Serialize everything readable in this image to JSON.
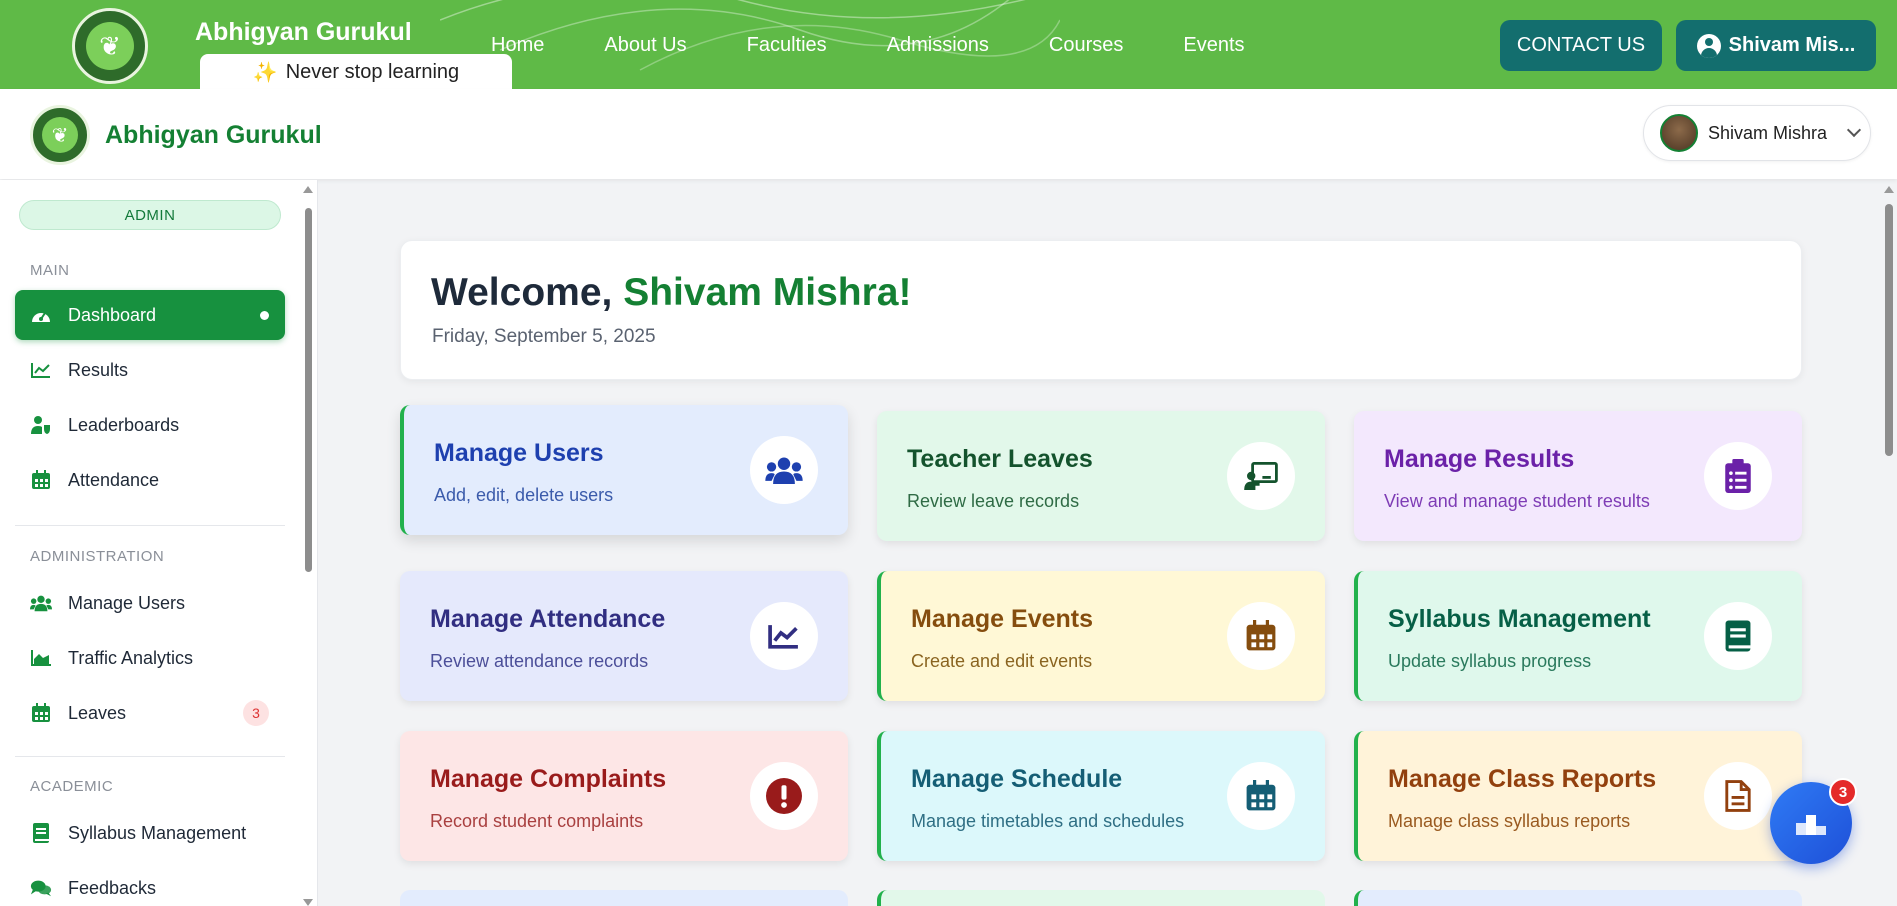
{
  "topbar": {
    "brand": "Abhigyan Gurukul",
    "tagline": "Never stop learning",
    "nav": [
      "Home",
      "About Us",
      "Faculties",
      "Admissions",
      "Courses",
      "Events"
    ],
    "contact_label": "CONTACT US",
    "user_label": "Shivam Mis...",
    "bg_color": "#5fba47",
    "button_color": "#136e6e"
  },
  "header": {
    "title": "Abhigyan Gurukul",
    "profile_name": "Shivam Mishra"
  },
  "sidebar": {
    "role_badge": "ADMIN",
    "sections": [
      {
        "title": "MAIN",
        "items": [
          {
            "label": "Dashboard",
            "icon": "gauge-icon",
            "active": true
          },
          {
            "label": "Results",
            "icon": "chart-line-icon"
          },
          {
            "label": "Leaderboards",
            "icon": "user-shield-icon"
          },
          {
            "label": "Attendance",
            "icon": "calendar-icon"
          }
        ]
      },
      {
        "title": "ADMINISTRATION",
        "items": [
          {
            "label": "Manage Users",
            "icon": "users-icon"
          },
          {
            "label": "Traffic Analytics",
            "icon": "chart-area-icon"
          },
          {
            "label": "Leaves",
            "icon": "calendar-icon",
            "badge": "3"
          }
        ]
      },
      {
        "title": "ACADEMIC",
        "items": [
          {
            "label": "Syllabus Management",
            "icon": "book-icon"
          },
          {
            "label": "Feedbacks",
            "icon": "comments-icon"
          }
        ]
      }
    ],
    "accent": "#17913f"
  },
  "welcome": {
    "greeting": "Welcome,",
    "name": "Shivam Mishra!",
    "date": "Friday, September 5, 2025"
  },
  "cards": [
    {
      "title": "Manage Users",
      "subtitle": "Add, edit, delete users",
      "icon": "users-icon",
      "bg": "#e3ecfd",
      "color": "#1e40af"
    },
    {
      "title": "Teacher Leaves",
      "subtitle": "Review leave records",
      "icon": "chalkboard-teacher-icon",
      "bg": "#e2f8ea",
      "color": "#14532d"
    },
    {
      "title": "Manage Results",
      "subtitle": "View and manage student results",
      "icon": "clipboard-list-icon",
      "bg": "#f3e8fd",
      "color": "#6b21a8"
    },
    {
      "title": "Manage Attendance",
      "subtitle": "Review attendance records",
      "icon": "chart-line-icon",
      "bg": "#e5e9fc",
      "color": "#312e81"
    },
    {
      "title": "Manage Events",
      "subtitle": "Create and edit events",
      "icon": "calendar-icon",
      "bg": "#fff8d6",
      "color": "#854d0e"
    },
    {
      "title": "Syllabus Management",
      "subtitle": "Update syllabus progress",
      "icon": "book-icon",
      "bg": "#dff8ec",
      "color": "#065f46"
    },
    {
      "title": "Manage Complaints",
      "subtitle": "Record student complaints",
      "icon": "exclamation-circle-icon",
      "bg": "#fde6e6",
      "color": "#991b1b"
    },
    {
      "title": "Manage Schedule",
      "subtitle": "Manage timetables and schedules",
      "icon": "calendar-icon",
      "bg": "#dcf8fb",
      "color": "#155e75"
    },
    {
      "title": "Manage Class Reports",
      "subtitle": "Manage class syllabus reports",
      "icon": "file-icon",
      "bg": "#fff3d9",
      "color": "#92400e"
    }
  ],
  "fab": {
    "badge": "3",
    "icon": "podium-icon"
  }
}
